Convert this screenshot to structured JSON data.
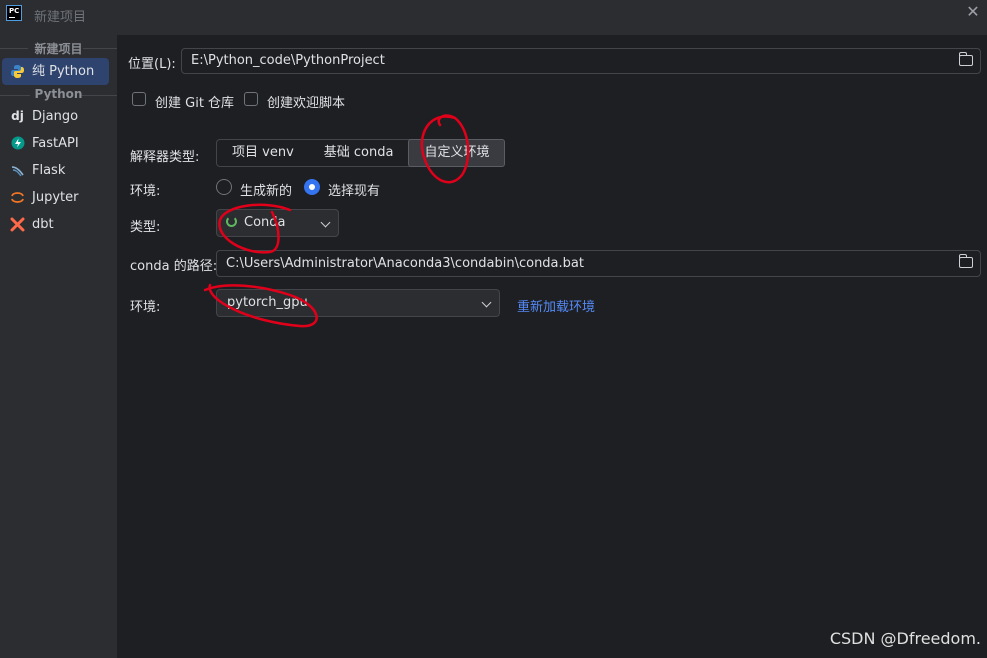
{
  "window": {
    "title": "新建项目",
    "app_icon_text": "PC"
  },
  "sidebar": {
    "group_1": "新建项目",
    "items_1": [
      {
        "label": "纯 Python",
        "icon": "python-icon"
      }
    ],
    "group_2": "Python",
    "items_2": [
      {
        "label": "Django",
        "icon": "django-icon",
        "glyph": "dj"
      },
      {
        "label": "FastAPI",
        "icon": "fastapi-icon"
      },
      {
        "label": "Flask",
        "icon": "flask-icon"
      },
      {
        "label": "Jupyter",
        "icon": "jupyter-icon"
      },
      {
        "label": "dbt",
        "icon": "dbt-icon"
      }
    ]
  },
  "form": {
    "location_label": "位置(L):",
    "location_value": "E:\\Python_code\\PythonProject",
    "create_git_label": "创建 Git 仓库",
    "create_welcome_label": "创建欢迎脚本",
    "interpreter_type_label": "解释器类型:",
    "interpreter_types": [
      "项目 venv",
      "基础 conda",
      "自定义环境"
    ],
    "interpreter_selected": "自定义环境",
    "env_label": "环境:",
    "env_options": [
      "生成新的",
      "选择现有"
    ],
    "env_selected": "选择现有",
    "type_label": "类型:",
    "type_value": "Conda",
    "conda_path_label": "conda 的路径:",
    "conda_path_value": "C:\\Users\\Administrator\\Anaconda3\\condabin\\conda.bat",
    "env2_label": "环境:",
    "env2_value": "pytorch_gpu",
    "reload_link": "重新加载环境"
  },
  "watermark": "CSDN @Dfreedom.",
  "colors": {
    "accent": "#3574f0",
    "selected_nav": "#2e436e",
    "link": "#548af7",
    "annotation": "#e0001a"
  }
}
